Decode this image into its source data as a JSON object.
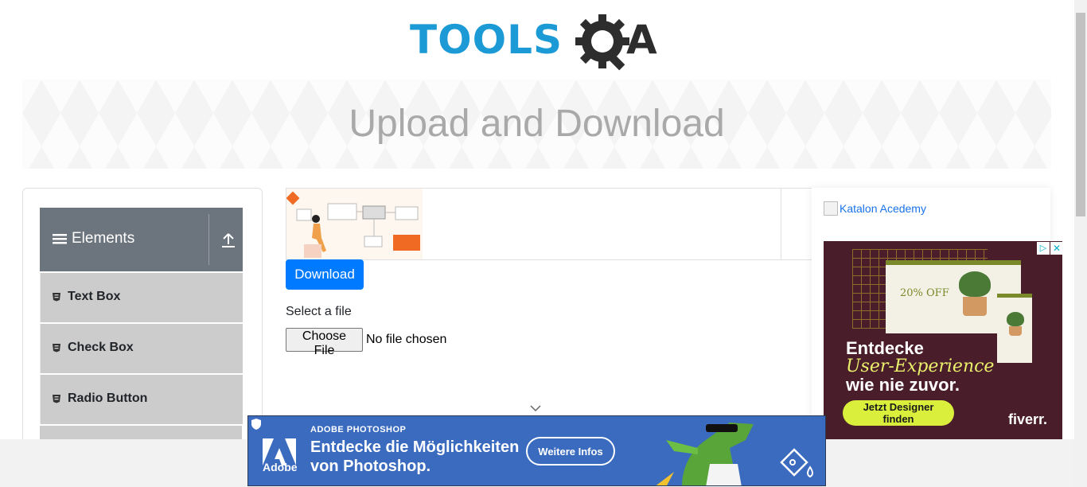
{
  "logo": {
    "text": "TOOLS",
    "text_after": "A",
    "brand_color": "#1c9ad6"
  },
  "banner": {
    "title": "Upload and Download"
  },
  "sidebar": {
    "group_title": "Elements",
    "items": [
      {
        "label": "Text Box"
      },
      {
        "label": "Check Box"
      },
      {
        "label": "Radio Button"
      }
    ]
  },
  "main": {
    "download_label": "Download",
    "select_label": "Select a file",
    "choose_file_label": "Choose File",
    "no_file_text": "No file chosen"
  },
  "right_ad": {
    "image_alt": "Katalon Acedemy",
    "offer": "20% OFF",
    "line1": "Entdecke",
    "line2": "User-Experience",
    "line3": "wie nie zuvor.",
    "cta": "Jetzt Designer finden",
    "brand": "fiverr."
  },
  "bottom_ad": {
    "product": "ADOBE PHOTOSHOP",
    "headline1": "Entdecke die Möglichkeiten",
    "headline2": "von Photoshop.",
    "cta": "Weitere Infos",
    "brand": "Adobe"
  },
  "colors": {
    "primary": "#007bff",
    "sidebar_header": "#6c757d",
    "sidebar_item": "#cccccc",
    "ad_bg": "#4a1d2b",
    "adobe_bg": "#3a6bbf"
  }
}
